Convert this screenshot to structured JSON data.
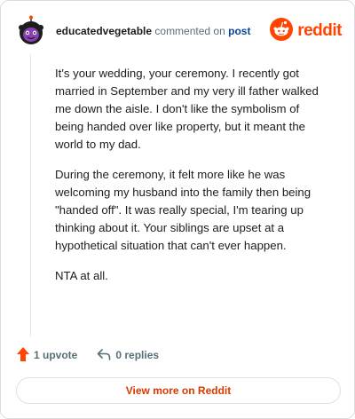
{
  "header": {
    "username": "educatedvegetable",
    "verb": "commented on",
    "post_link": "post",
    "brand": "reddit",
    "avatar_icon": "avatar-icon",
    "brand_icon": "reddit-logo-icon"
  },
  "comment": {
    "paragraphs": [
      "It's your wedding, your ceremony. I recently got married in September and my very ill father walked me down the aisle. I don't like the symbolism of being handed over like property, but it meant the world to my dad.",
      "During the ceremony, it felt more like he was welcoming my husband into the family then being \"handed off\". It was really special, I'm tearing up thinking about it. Your siblings are upset at a hypothetical situation that can't ever happen.",
      "NTA at all."
    ]
  },
  "actions": {
    "upvotes": "1 upvote",
    "replies": "0 replies",
    "upvote_icon": "upvote-arrow-icon",
    "reply_icon": "reply-icon"
  },
  "footer": {
    "view_more": "View more on Reddit"
  },
  "colors": {
    "accent": "#ff4500",
    "link": "#0a449b",
    "muted": "#576f76"
  }
}
